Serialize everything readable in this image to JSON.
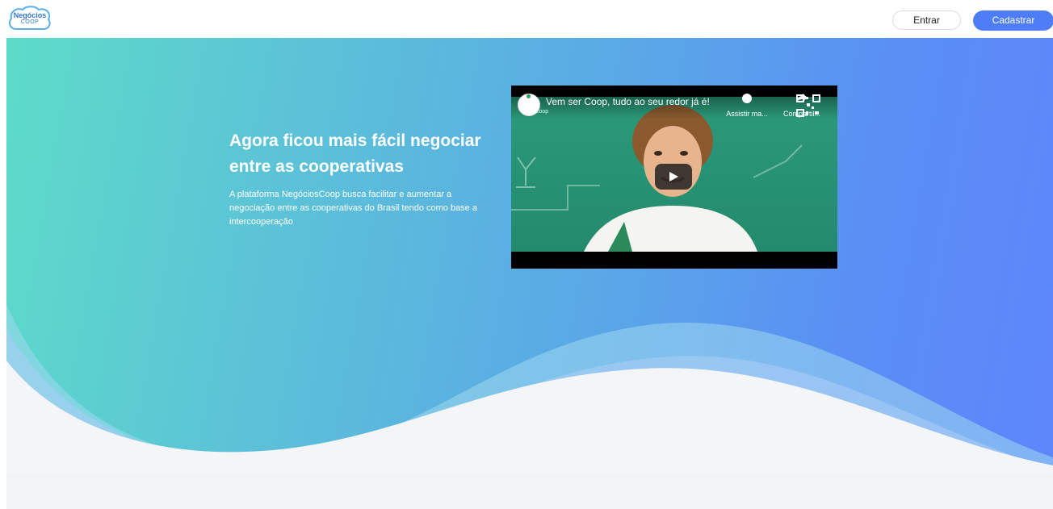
{
  "header": {
    "logo_line1": "Negócios",
    "logo_line2": "COOP",
    "login_label": "Entrar",
    "signup_label": "Cadastrar"
  },
  "hero": {
    "title": "Agora ficou mais fácil negociar entre as cooperativas",
    "description": "A plataforma NegóciosCoop busca facilitar e aumentar a negociação entre as cooperativas do Brasil tendo como base a intercooperação"
  },
  "video": {
    "title": "Vem ser Coop, tudo ao seu redor já é!",
    "channel": "coop",
    "watch_later_label": "Assistir ma...",
    "share_label": "Compartil...",
    "icons": [
      "clock-icon",
      "share-icon",
      "play-icon"
    ]
  },
  "colors": {
    "accent": "#4f7cf7",
    "gradient_start": "#5ddbc8",
    "gradient_end": "#5e86fb",
    "background_bottom": "#f2f3f5"
  }
}
